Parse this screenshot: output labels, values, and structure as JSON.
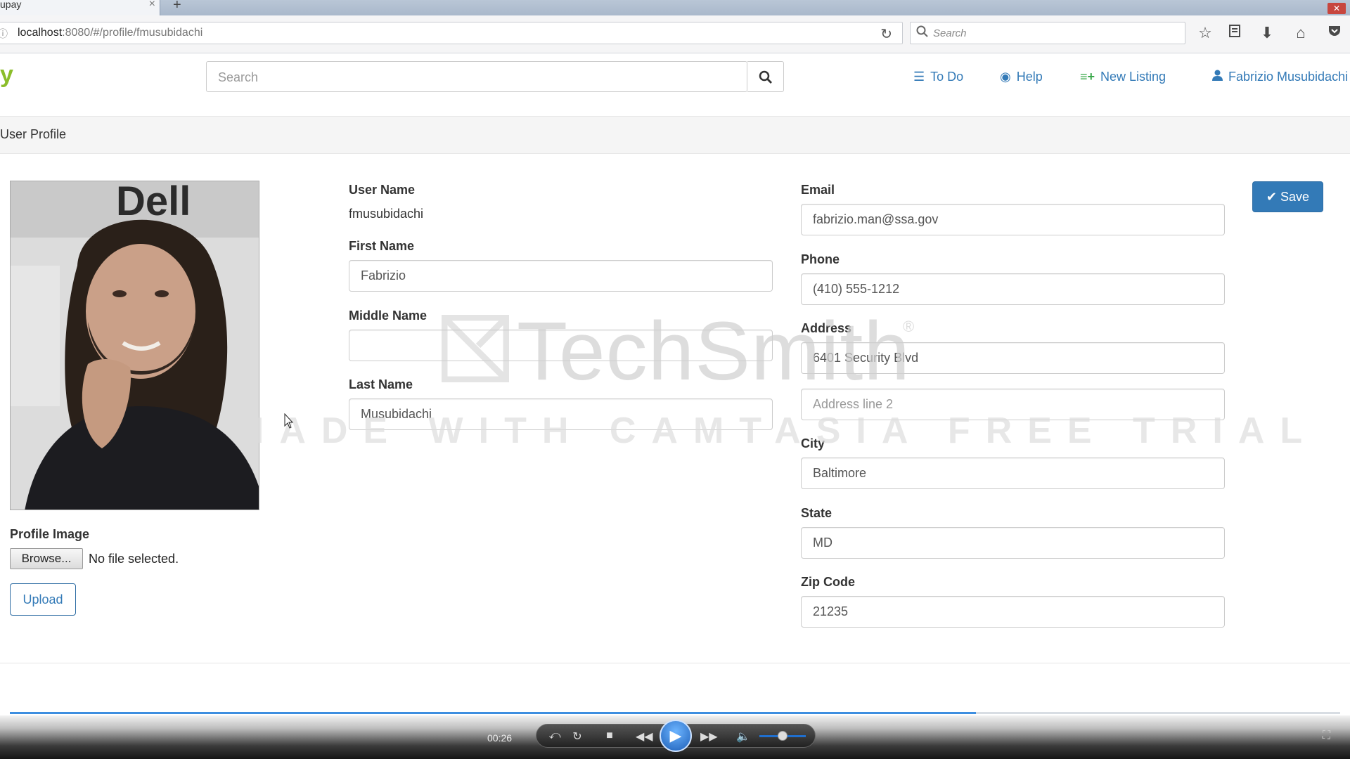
{
  "browser": {
    "tab_title": "upay",
    "tab_close": "×",
    "new_tab": "+",
    "url_host": "localhost",
    "url_path": ":8080/#/profile/fmusubidachi",
    "search_placeholder": "Search"
  },
  "app": {
    "brand": "y",
    "search_placeholder": "Search",
    "nav": {
      "todo": "To Do",
      "help": "Help",
      "new_listing": "New Listing",
      "user": "Fabrizio Musubidachi"
    },
    "page_title": "User Profile"
  },
  "profile": {
    "username_label": "User Name",
    "username": "fmusubidachi",
    "first_name_label": "First Name",
    "first_name": "Fabrizio",
    "middle_name_label": "Middle Name",
    "middle_name": "",
    "last_name_label": "Last Name",
    "last_name": "Musubidachi",
    "email_label": "Email",
    "email": "fabrizio.man@ssa.gov",
    "phone_label": "Phone",
    "phone": "(410) 555-1212",
    "address_label": "Address",
    "address1": "6401 Security Blvd",
    "address2_placeholder": "Address line 2",
    "city_label": "City",
    "city": "Baltimore",
    "state_label": "State",
    "state": "MD",
    "zip_label": "Zip Code",
    "zip": "21235",
    "image_label": "Profile Image",
    "browse_label": "Browse...",
    "no_file": "No file selected.",
    "upload_label": "Upload",
    "save_label": "Save"
  },
  "watermark": {
    "brand": "TechSmith",
    "reg": "®",
    "trial": "MADE WITH CAMTASIA FREE TRIAL"
  },
  "player": {
    "time": "00:26",
    "progress_fraction": 0.726
  },
  "colors": {
    "accent": "#337ab7",
    "brand": "#8bbd2a",
    "new_listing_icon": "#3aa84a"
  },
  "icons": {
    "todo": "list-icon",
    "help": "lifebuoy-icon",
    "new_listing": "plus-list-icon",
    "user": "user-icon",
    "search": "search-icon"
  }
}
